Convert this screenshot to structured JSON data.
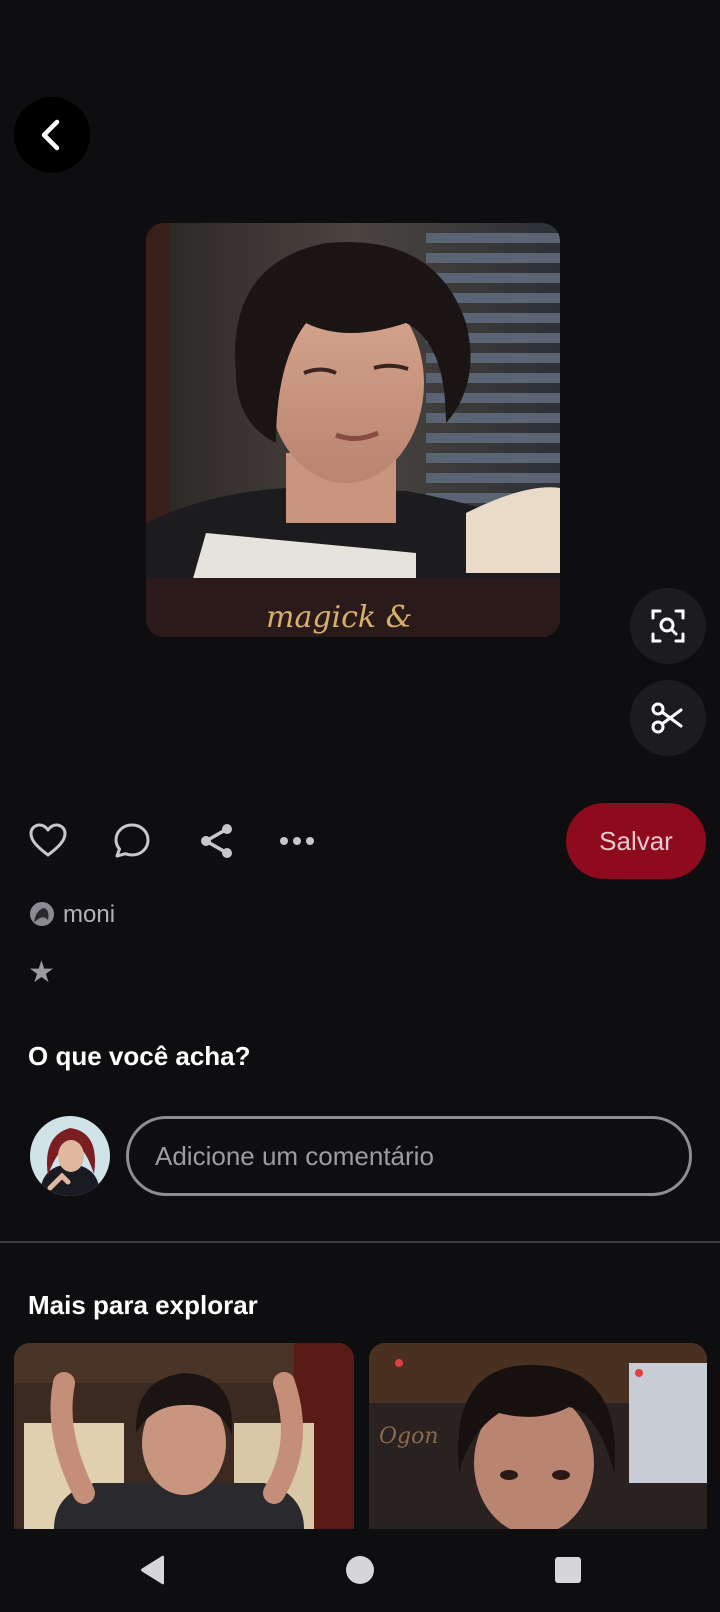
{
  "pin": {
    "image_alt": "pin-image",
    "save_label": "Salvar"
  },
  "author": {
    "name": "moni"
  },
  "rating": {
    "star": "★"
  },
  "comments": {
    "title": "O que você acha?",
    "placeholder": "Adicione um comentário"
  },
  "explore": {
    "title": "Mais para explorar"
  },
  "colors": {
    "background": "#0e0d10",
    "save_button": "#8e0a1d",
    "save_text": "#e8c9cd",
    "icon": "#c8c8cc"
  },
  "icons": {
    "back": "chevron-left-icon",
    "lens": "visual-search-icon",
    "cut": "scissors-icon",
    "like": "heart-icon",
    "comment": "speech-bubble-icon",
    "share": "share-icon",
    "more": "more-dots-icon",
    "nav_back": "triangle-back-icon",
    "nav_home": "circle-home-icon",
    "nav_recent": "square-recents-icon"
  }
}
